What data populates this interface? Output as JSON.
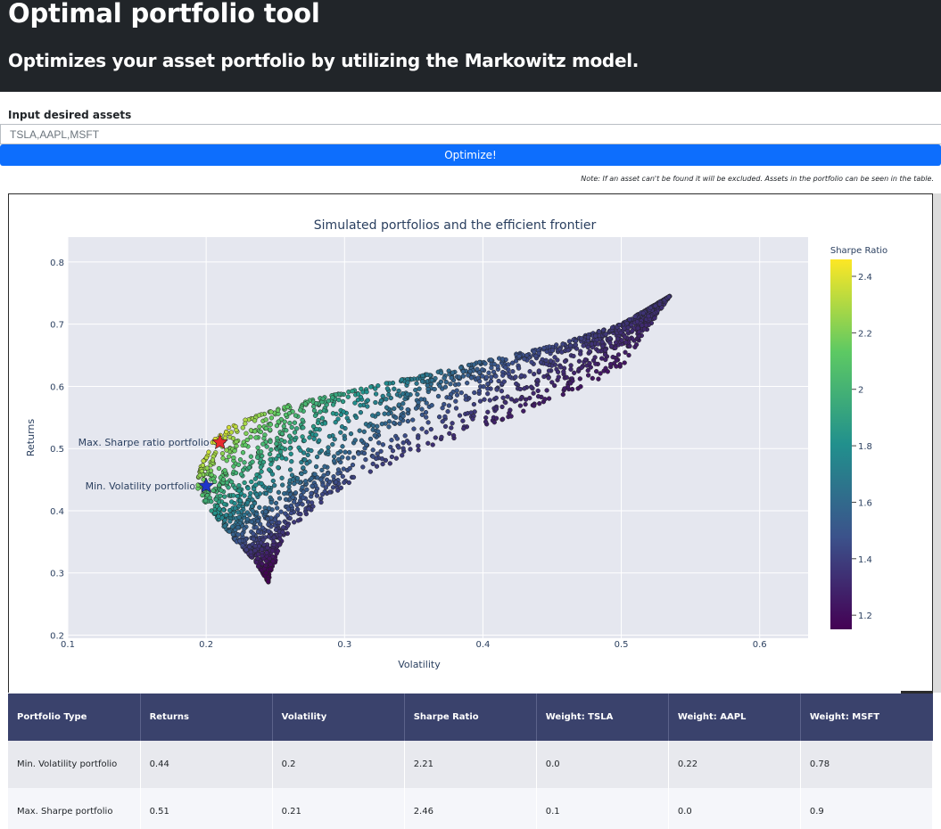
{
  "header": {
    "title": "Optimal portfolio tool",
    "subtitle": "Optimizes your asset portfolio by utilizing the Markowitz model."
  },
  "form": {
    "label": "Input desired assets",
    "input_value": "TSLA,AAPL,MSFT",
    "button_label": "Optimize!",
    "note": "Note: If an asset can't be found it will be excluded. Assets in the portfolio can be seen in the table."
  },
  "chart_data": {
    "type": "scatter",
    "title": "Simulated portfolios and the efficient frontier",
    "xlabel": "Volatility",
    "ylabel": "Returns",
    "xlim": [
      0.1,
      0.635
    ],
    "ylim": [
      0.195,
      0.84
    ],
    "x_ticks": [
      "0.1",
      "0.2",
      "0.3",
      "0.4",
      "0.5",
      "0.6"
    ],
    "y_ticks": [
      "0.2",
      "0.3",
      "0.4",
      "0.5",
      "0.6",
      "0.7",
      "0.8"
    ],
    "colorbar": {
      "title": "Sharpe Ratio",
      "range": [
        1.15,
        2.46
      ],
      "ticks": [
        "1.2",
        "1.4",
        "1.6",
        "1.8",
        "2",
        "2.2",
        "2.4"
      ]
    },
    "grid": true,
    "series": [
      {
        "name": "Simulated portfolios",
        "point_count": 5000,
        "frontier_left_edge": [
          [
            0.245,
            0.285
          ],
          [
            0.235,
            0.32
          ],
          [
            0.218,
            0.36
          ],
          [
            0.2,
            0.41
          ],
          [
            0.193,
            0.44
          ],
          [
            0.197,
            0.48
          ],
          [
            0.205,
            0.515
          ],
          [
            0.22,
            0.54
          ],
          [
            0.26,
            0.57
          ],
          [
            0.3,
            0.59
          ],
          [
            0.35,
            0.615
          ],
          [
            0.4,
            0.64
          ],
          [
            0.45,
            0.665
          ],
          [
            0.5,
            0.7
          ],
          [
            0.535,
            0.745
          ]
        ],
        "frontier_right_edge": [
          [
            0.245,
            0.285
          ],
          [
            0.255,
            0.35
          ],
          [
            0.27,
            0.39
          ],
          [
            0.3,
            0.44
          ],
          [
            0.35,
            0.49
          ],
          [
            0.4,
            0.535
          ],
          [
            0.45,
            0.575
          ],
          [
            0.5,
            0.63
          ],
          [
            0.535,
            0.745
          ]
        ]
      }
    ],
    "annotations": [
      {
        "label": "Max. Sharpe ratio portfolio",
        "x": 0.21,
        "y": 0.51,
        "marker": "star",
        "color": "#e8292f"
      },
      {
        "label": "Min. Volatility portfolio",
        "x": 0.2,
        "y": 0.44,
        "marker": "star",
        "color": "#1f35c9"
      }
    ]
  },
  "table": {
    "headers": [
      "Portfolio Type",
      "Returns",
      "Volatility",
      "Sharpe Ratio",
      "Weight: TSLA",
      "Weight: AAPL",
      "Weight: MSFT"
    ],
    "rows": [
      [
        "Min. Volatility portfolio",
        "0.44",
        "0.2",
        "2.21",
        "0.0",
        "0.22",
        "0.78"
      ],
      [
        "Max. Sharpe portfolio",
        "0.51",
        "0.21",
        "2.46",
        "0.1",
        "0.0",
        "0.9"
      ]
    ]
  },
  "colors": {
    "header_bg": "#212529",
    "button_bg": "#0d6efd",
    "plot_bg": "#e5e7ef",
    "table_header_bg": "#3a426c"
  }
}
